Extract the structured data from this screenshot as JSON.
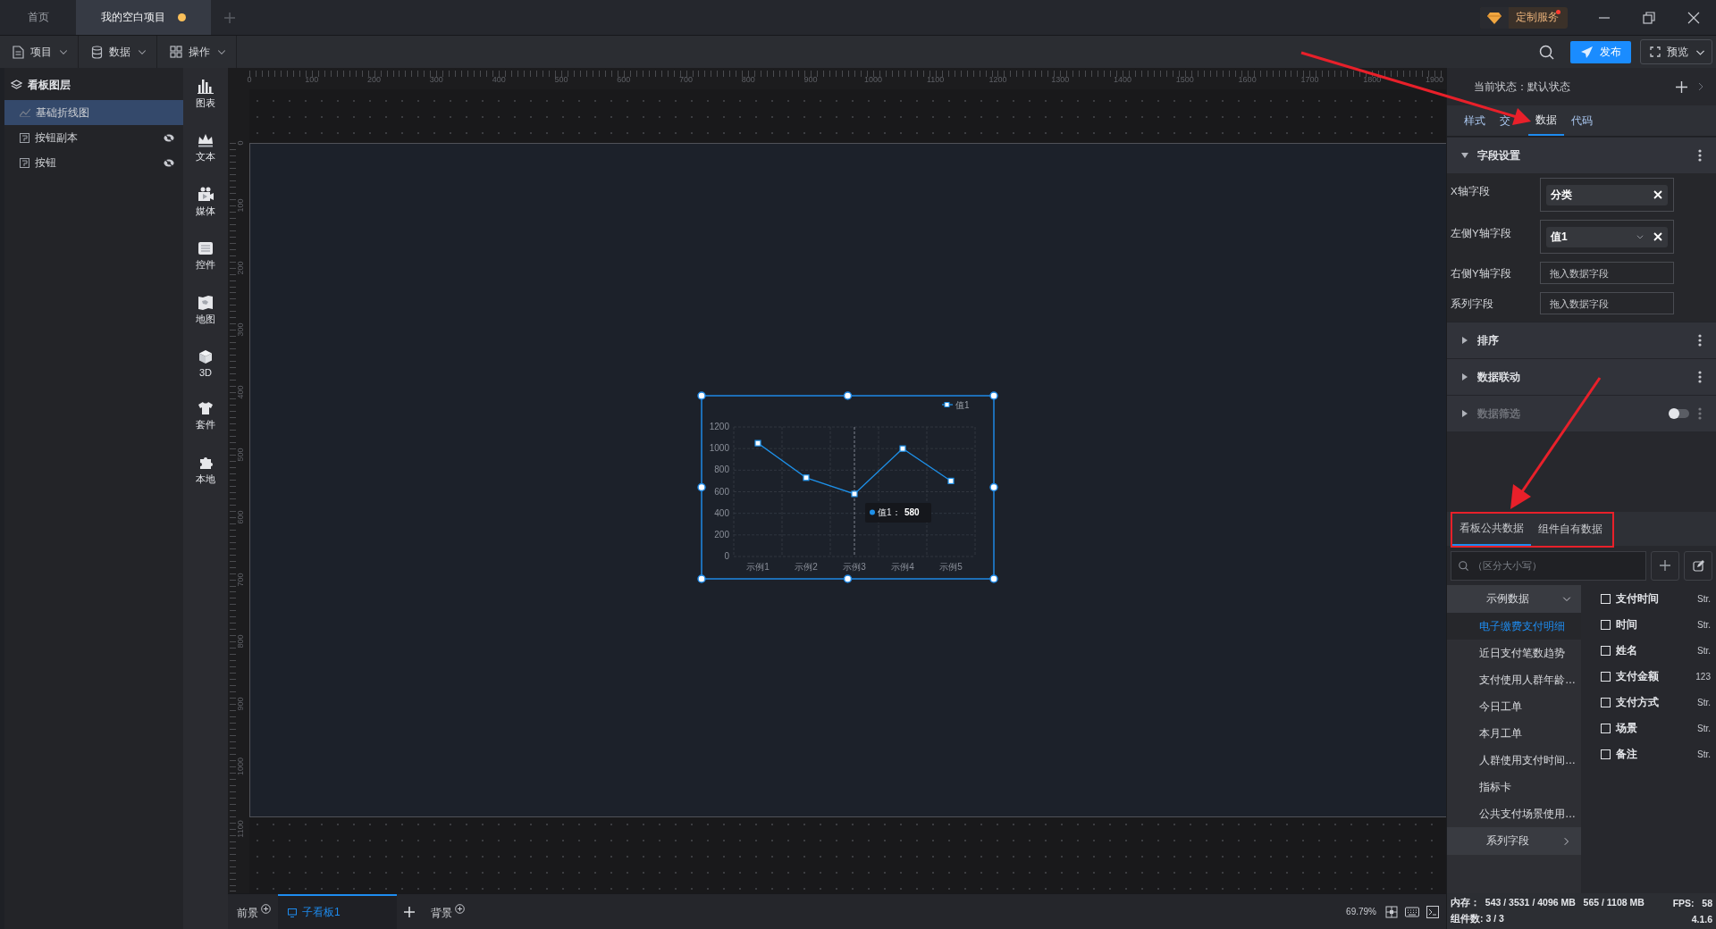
{
  "title_bar": {
    "tabs": [
      {
        "label": "首页",
        "selected": false,
        "unsaved": false
      },
      {
        "label": "我的空白项目",
        "selected": true,
        "unsaved": true
      }
    ],
    "service_badge": "定制服务"
  },
  "toolbar": {
    "menus": [
      {
        "label": "项目",
        "kind": "file"
      },
      {
        "label": "数据",
        "kind": "data"
      },
      {
        "label": "操作",
        "kind": "grid"
      }
    ],
    "publish": "发布",
    "preview": "预览"
  },
  "layers": {
    "title": "看板图层",
    "items": [
      {
        "label": "基础折线图",
        "kind": "chart",
        "selected": true,
        "hidden": false
      },
      {
        "label": "按钮副本",
        "kind": "button",
        "selected": false,
        "hidden": true
      },
      {
        "label": "按钮",
        "kind": "button",
        "selected": false,
        "hidden": true
      }
    ]
  },
  "palette": [
    {
      "label": "图表",
      "kind": "chart"
    },
    {
      "label": "文本",
      "kind": "text"
    },
    {
      "label": "媒体",
      "kind": "media"
    },
    {
      "label": "控件",
      "kind": "control"
    },
    {
      "label": "地图",
      "kind": "map"
    },
    {
      "label": "3D",
      "kind": "cube"
    },
    {
      "label": "套件",
      "kind": "kit"
    },
    {
      "label": "本地",
      "kind": "local"
    }
  ],
  "rulers": {
    "horizontal": [
      "0",
      "100",
      "200",
      "300",
      "400",
      "500",
      "600",
      "700",
      "800",
      "900",
      "1000",
      "1100",
      "1200",
      "1300",
      "1400",
      "1500",
      "1600",
      "1700",
      "1800",
      "1900"
    ],
    "vertical": [
      "0",
      "100",
      "200",
      "300",
      "400",
      "500",
      "600",
      "700",
      "800",
      "900",
      "1000",
      "1100"
    ]
  },
  "chart": {
    "chart_data": {
      "type": "line",
      "categories": [
        "示例1",
        "示例2",
        "示例3",
        "示例4",
        "示例5"
      ],
      "series": [
        {
          "name": "值1",
          "color": "#1e90e8",
          "values": [
            1050,
            730,
            580,
            1000,
            700
          ],
          "marker": "square"
        }
      ],
      "ylim": [
        0,
        1200
      ],
      "yticks": [
        0,
        200,
        400,
        600,
        800,
        1000,
        1200
      ],
      "grid": true,
      "ref_lines": [
        {
          "axis": "x",
          "value": "示例3"
        }
      ]
    },
    "tooltip": {
      "label": "值1：",
      "value": "580"
    }
  },
  "bottom_bar": {
    "foreground": "前景",
    "board_tab": {
      "label": "子看板1",
      "selected": true
    },
    "background": "背景",
    "zoom": "69.79%"
  },
  "inspector": {
    "state": "当前状态：默认状态",
    "tabs": [
      {
        "label": "样式",
        "selected": false
      },
      {
        "label": "交",
        "selected": false
      },
      {
        "label": "数据",
        "selected": true
      },
      {
        "label": "代码",
        "selected": false
      }
    ],
    "sections": [
      {
        "title": "字段设置",
        "expanded": true,
        "disabled": false,
        "fields": [
          {
            "label": "X轴字段",
            "value": "分类",
            "dropdown": false
          },
          {
            "label": "左侧Y轴字段",
            "value": "值1",
            "dropdown": true
          },
          {
            "label": "右侧Y轴字段",
            "placeholder": "拖入数据字段"
          },
          {
            "label": "系列字段",
            "placeholder": "拖入数据字段"
          }
        ]
      },
      {
        "title": "排序",
        "expanded": false,
        "disabled": false
      },
      {
        "title": "数据联动",
        "expanded": false,
        "disabled": false
      },
      {
        "title": "数据筛选",
        "expanded": false,
        "disabled": true,
        "toggle": {
          "on": false
        }
      }
    ]
  },
  "data_source": {
    "tabs": [
      {
        "label": "看板公共数据",
        "selected": true
      },
      {
        "label": "组件自有数据",
        "selected": false
      }
    ],
    "search": {
      "placeholder": "（区分大小写）"
    },
    "groups": [
      {
        "label": "示例数据",
        "expanded": true,
        "items": [
          {
            "label": "电子缴费支付明细",
            "selected": true
          },
          {
            "label": "近日支付笔数趋势",
            "selected": false
          },
          {
            "label": "支付使用人群年龄…",
            "selected": false
          },
          {
            "label": "今日工单",
            "selected": false
          },
          {
            "label": "本月工单",
            "selected": false
          },
          {
            "label": "人群使用支付时间…",
            "selected": false
          },
          {
            "label": "指标卡",
            "selected": false
          },
          {
            "label": "公共支付场景使用…",
            "selected": false
          }
        ]
      },
      {
        "label": "系列字段",
        "expanded": false
      }
    ],
    "fields": [
      {
        "name": "支付时间",
        "type": "Str.",
        "checked": false
      },
      {
        "name": "时间",
        "type": "Str.",
        "checked": false
      },
      {
        "name": "姓名",
        "type": "Str.",
        "checked": false
      },
      {
        "name": "支付金额",
        "type": "123",
        "checked": false
      },
      {
        "name": "支付方式",
        "type": "Str.",
        "checked": false
      },
      {
        "name": "场景",
        "type": "Str.",
        "checked": false
      },
      {
        "name": "备注",
        "type": "Str.",
        "checked": false
      }
    ]
  },
  "status_bar": {
    "memory": "内存：  543 / 3531 / 4096 MB   565 / 1108 MB",
    "fps": "FPS:   58",
    "components": "组件数: 3 / 3",
    "version": "4.1.6"
  }
}
